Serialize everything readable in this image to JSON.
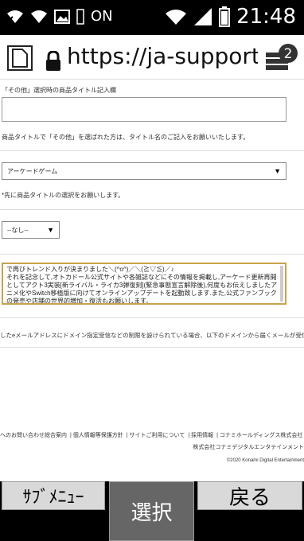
{
  "statusbar": {
    "on_label": "ON",
    "time": "21:48",
    "icons": [
      "wifi-off-icon",
      "wifi-icon",
      "image-icon",
      "sim-icon",
      "wifi-signal-icon",
      "signal-icon",
      "battery-icon"
    ]
  },
  "urlbar": {
    "url": "https://ja-support.k",
    "tab_count": "2"
  },
  "form": {
    "other_title_label": "「その他」選択時の商品タイトル記入欄",
    "other_title_note": "商品タイトルで「その他」を選ばれた方は、タイトル名のご記入をお願いいたします。",
    "category_select_value": "アーケードゲーム",
    "category_note": "*先に商品タイトルの選択をお願いします。",
    "title_select_value": "--なし--",
    "message_lines": [
      "で再びトレンド入りが決まりました＼(^o^)／＼(≧▽≦)／♪",
      "それを記念して,オトカドール公式サイトや各雑誌などにその情報を掲載し,アーケード更新再開としてアクト3実装[新ライバル・ライカ3弾復刻](緊急事態宣言解除後),何度もお伝えしましたアニメ化やSwitch移植版に向けてオンラインアップデートを起動致します.また,公式ファンブックの発売や店舗の世界的増加・復活もお願いします。"
    ],
    "domain_note": "したeメールアドレスにドメイン指定受信などの制限を設けられている場合、以下のドメインから届くメールが受信できるよ"
  },
  "footer": {
    "links": [
      "へのお問い合わせ総合案内",
      "個人情報等保護方針",
      "サイトご利用について",
      "採用情報",
      "コナミホールディングス株式会社"
    ],
    "company": "株式会社コナミデジタルエンタテインメント",
    "copyright": "©2020 Konami Digital Entertainment"
  },
  "softkeys": {
    "left": "ｻﾌﾞﾒﾆｭｰ",
    "center": "選択",
    "right": "戻る"
  }
}
